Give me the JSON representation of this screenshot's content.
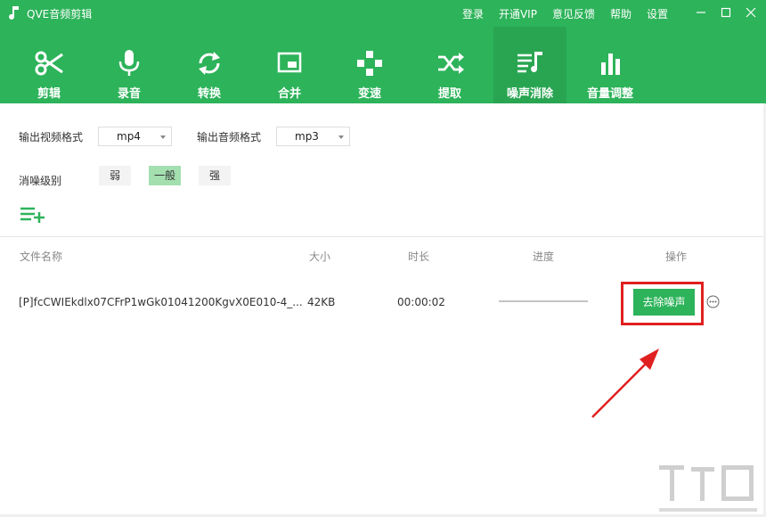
{
  "app": {
    "title": "QVE音频剪辑"
  },
  "top_links": [
    "登录",
    "开通VIP",
    "意见反馈",
    "帮助",
    "设置"
  ],
  "toolbar": [
    {
      "label": "剪辑",
      "icon": "scissors-icon",
      "active": false
    },
    {
      "label": "录音",
      "icon": "microphone-icon",
      "active": false
    },
    {
      "label": "转换",
      "icon": "refresh-icon",
      "active": false
    },
    {
      "label": "合并",
      "icon": "merge-window-icon",
      "active": false
    },
    {
      "label": "变速",
      "icon": "speed-icon",
      "active": false
    },
    {
      "label": "提取",
      "icon": "shuffle-icon",
      "active": false
    },
    {
      "label": "噪声消除",
      "icon": "noise-music-icon",
      "active": true
    },
    {
      "label": "音量调整",
      "icon": "volume-bars-icon",
      "active": false
    }
  ],
  "settings": {
    "video_format_label": "输出视频格式",
    "video_format_value": "mp4",
    "audio_format_label": "输出音频格式",
    "audio_format_value": "mp3",
    "denoise_level_label": "消噪级别",
    "levels": [
      "弱",
      "一般",
      "强"
    ],
    "selected_level": "一般"
  },
  "table": {
    "headers": {
      "name": "文件名称",
      "size": "大小",
      "duration": "时长",
      "progress": "进度",
      "action": "操作"
    },
    "rows": [
      {
        "name": "[P]fcCWIEkdlx07CFrP1wGk01041200KgvX0E010-4_...",
        "size": "42KB",
        "duration": "00:00:02",
        "progress": 0,
        "action_label": "去除噪声"
      }
    ]
  },
  "colors": {
    "brand": "#2db35a",
    "active_tab": "#29a552",
    "highlight_box": "#e02020",
    "selected_level": "#a4dfb0"
  }
}
